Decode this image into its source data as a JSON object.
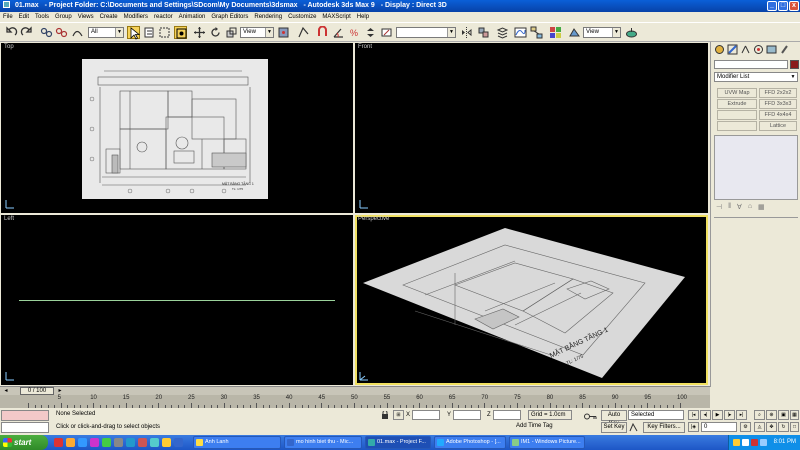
{
  "window": {
    "file": "01.max",
    "project": "- Project Folder: C:\\Documents and Settings\\SDcom\\My Documents\\3dsmax",
    "app": "- Autodesk 3ds Max 9",
    "display": "- Display : Direct 3D"
  },
  "menu": [
    "File",
    "Edit",
    "Tools",
    "Group",
    "Views",
    "Create",
    "Modifiers",
    "reactor",
    "Animation",
    "Graph Editors",
    "Rendering",
    "Customize",
    "MAXScript",
    "Help"
  ],
  "toolbar": {
    "selection_filter": "All",
    "ref_coord": "View",
    "named_selection": "",
    "render_view": "View"
  },
  "viewports": {
    "top": "Top",
    "front": "Front",
    "left": "Left",
    "perspective": "Perspective"
  },
  "plan_sheet": {
    "title": "MẶT BẰNG TẦNG 1",
    "scale": "TL: 1/75"
  },
  "command_panel": {
    "modifier_list": "Modifier List",
    "buttons": [
      "UVW Map",
      "FFD 2x2x2",
      "Extrude",
      "FFD 3x3x3",
      "",
      "FFD 4x4x4",
      "",
      "Lattice"
    ]
  },
  "time": {
    "slider": "0 / 100",
    "ticks": [
      "5",
      "10",
      "15",
      "20",
      "25",
      "30",
      "35",
      "40",
      "45",
      "50",
      "55",
      "60",
      "65",
      "70",
      "75",
      "80",
      "85",
      "90",
      "95",
      "100"
    ]
  },
  "status": {
    "selection": "None Selected",
    "prompt": "Click or click-and-drag to select objects",
    "x_label": "X",
    "y_label": "Y",
    "z_label": "Z",
    "grid": "Grid = 1.0cm",
    "add_time_tag": "Add Time Tag",
    "auto_key": "Auto Key",
    "selected": "Selected",
    "set_key": "Set Key",
    "key_filters": "Key Filters...",
    "frame": "0"
  },
  "taskbar": {
    "start": "start",
    "tasks": [
      "Anh Lanh",
      "mo hinh biet thu - Mic...",
      "01.max - Project F...",
      "Adobe Photoshop - [...",
      "IM1 - Windows Picture..."
    ],
    "clock": "8:01 PM"
  }
}
